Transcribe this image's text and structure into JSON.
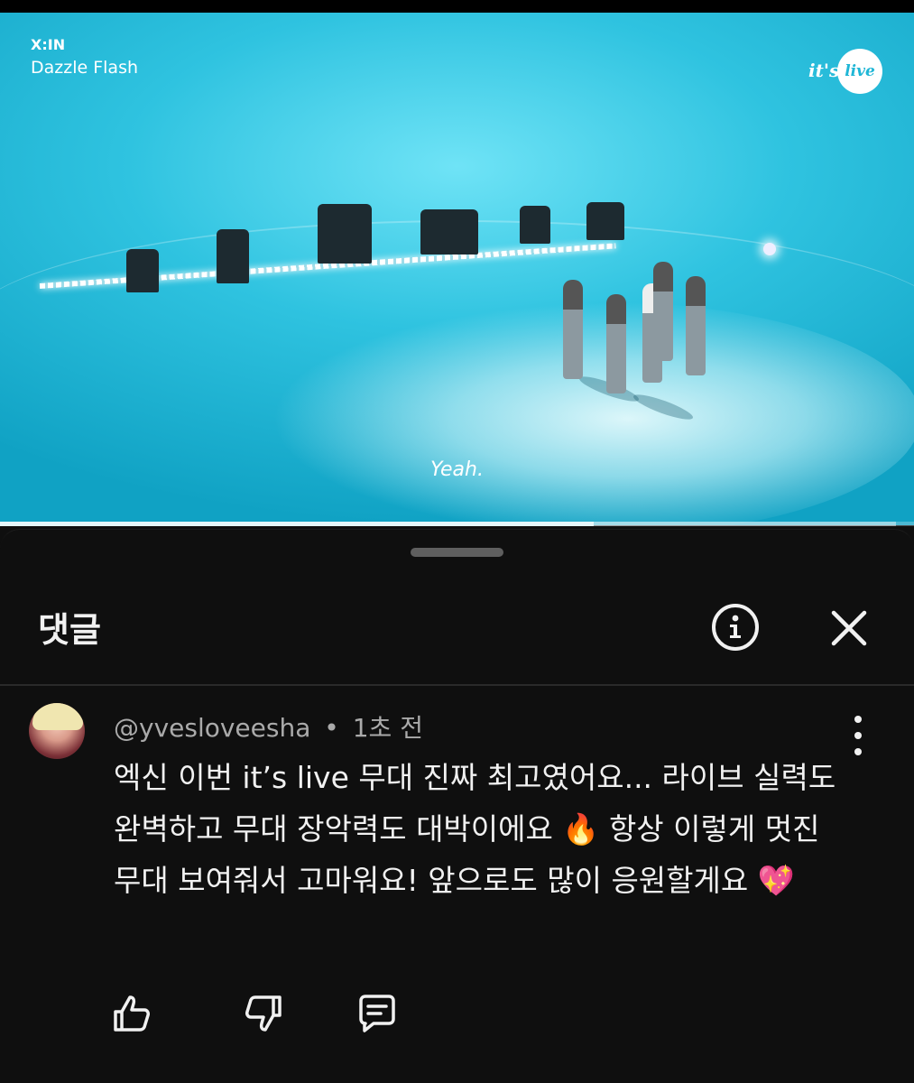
{
  "video": {
    "artist": "X:IN",
    "song": "Dazzle Flash",
    "logo_prefix": "it's",
    "logo_word": "live",
    "subtitle": "Yeah.",
    "progress": 0.65,
    "buffered": 0.98
  },
  "comments_panel": {
    "title": "댓글",
    "icons": {
      "info": "info-icon",
      "close": "close-icon"
    }
  },
  "comment": {
    "author": "@yvesloveesha",
    "separator": "•",
    "time": "1초 전",
    "text": "엑신 이번 it’s live 무대 진짜 최고였어요... 라이브 실력도 완벽하고 무대 장악력도 대박이에요 🔥 항상 이렇게 멋진 무대 보여줘서 고마워요! 앞으로도 많이 응원할게요 💖",
    "icons": {
      "more": "more-vertical-icon",
      "like": "thumbs-up-icon",
      "dislike": "thumbs-down-icon",
      "reply": "reply-icon"
    }
  }
}
